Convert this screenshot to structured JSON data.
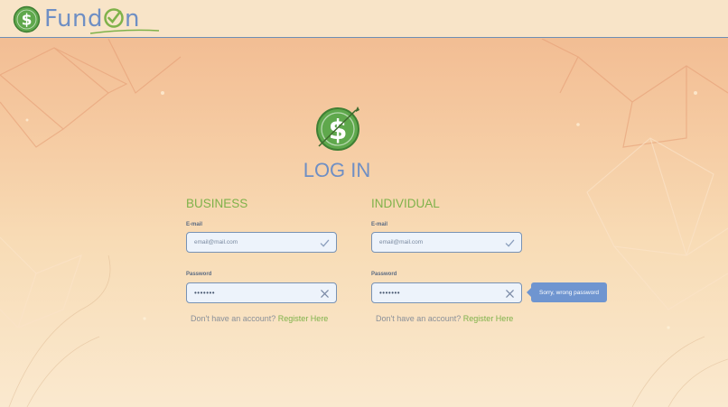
{
  "brand": {
    "name_prefix": "Fund",
    "name_suffix": "n",
    "icon": "dollar-coin-icon"
  },
  "main": {
    "title": "LOG IN",
    "logo_icon": "dollar-coin-icon"
  },
  "business": {
    "heading": "BUSINESS",
    "email_label": "E-mail",
    "email_value": "email@mail.com",
    "email_status_icon": "check-icon",
    "password_label": "Password",
    "password_value": "•••••••",
    "password_status_icon": "close-icon",
    "signup_text": "Don't have an account? ",
    "signup_link": "Register Here"
  },
  "individual": {
    "heading": "INDIVIDUAL",
    "email_label": "E-mail",
    "email_value": "email@mail.com",
    "email_status_icon": "check-icon",
    "password_label": "Password",
    "password_value": "•••••••",
    "password_status_icon": "close-icon",
    "signup_text": "Don't have an account? ",
    "signup_link": "Register Here",
    "error_tooltip": "Sorry, wrong password"
  },
  "colors": {
    "accent_blue": "#6f8fc4",
    "accent_green": "#7fb24a",
    "tooltip": "#6f95d0",
    "coin_green": "#5fa84c"
  }
}
